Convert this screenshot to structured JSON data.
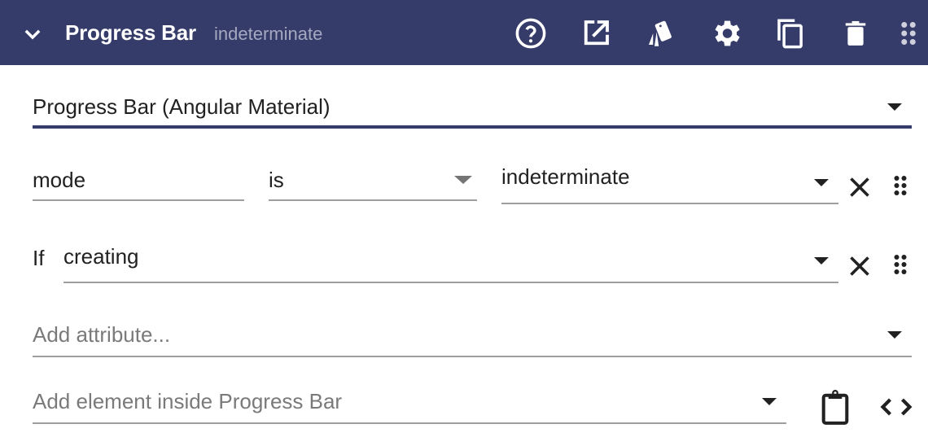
{
  "header": {
    "title": "Progress Bar",
    "subtitle": "indeterminate",
    "background": "#353c6a",
    "icons": [
      "chevron-down-icon",
      "help-icon",
      "open-in-new-icon",
      "style-swatch-icon",
      "settings-gear-icon",
      "copy-icon",
      "delete-trash-icon",
      "drag-handle-icon"
    ]
  },
  "component_select": {
    "value": "Progress Bar (Angular Material)",
    "accent": "#353c6a"
  },
  "attribute_row": {
    "name": "mode",
    "operator": "is",
    "value": "indeterminate"
  },
  "condition_row": {
    "label": "If",
    "value": "creating"
  },
  "add_attribute": {
    "placeholder": "Add attribute..."
  },
  "add_element": {
    "placeholder": "Add element inside Progress Bar"
  }
}
